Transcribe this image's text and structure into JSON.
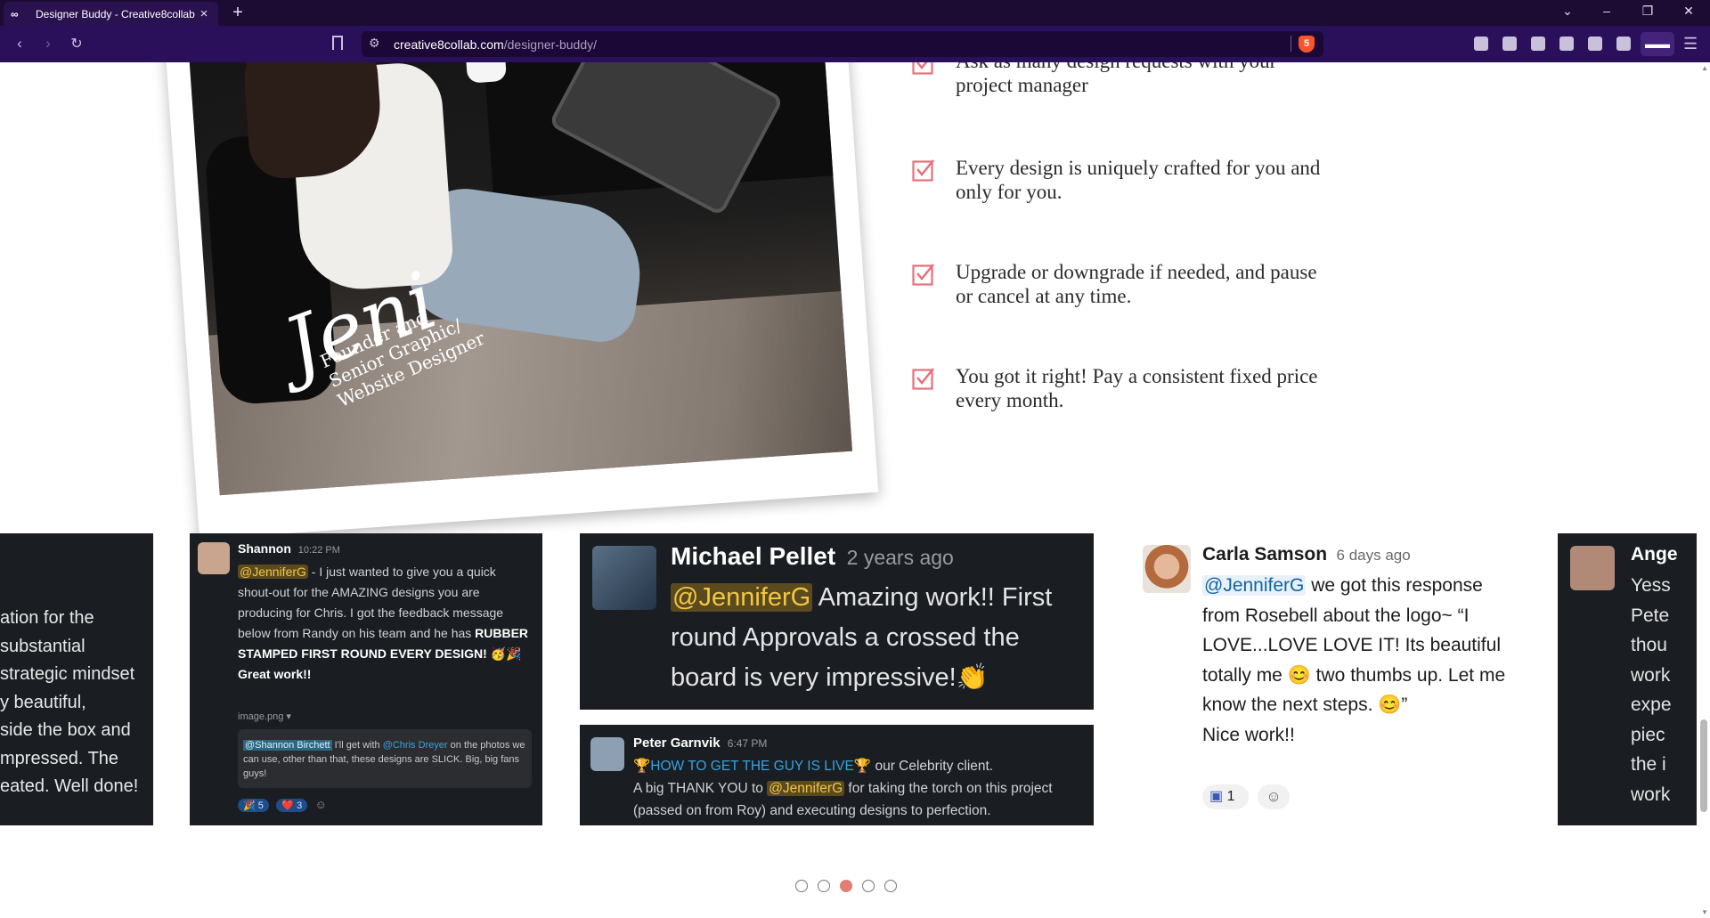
{
  "browser": {
    "tab_title": "Designer Buddy - Creative8collab",
    "tab_icon": "∞",
    "close_glyph": "×",
    "new_tab_glyph": "+",
    "url_host": "creative8collab.com",
    "url_path": "/designer-buddy/",
    "brave_badge": "5"
  },
  "features": [
    "Ask as many design requests with your project manager",
    "Every design is uniquely crafted for you and only for you.",
    "Upgrade or downgrade if needed, and pause or cancel at any time.",
    "You got it right! Pay a consistent fixed price every month."
  ],
  "photo": {
    "signature": "Jeni",
    "caption_1": "Founder and",
    "caption_2": "Senior Graphic/",
    "caption_3": "Website Designer"
  },
  "testimonials": {
    "left_partial": [
      "ation for the",
      "substantial",
      "strategic mindset",
      "y beautiful,",
      "side the box and",
      "mpressed. The",
      "eated. Well done!"
    ],
    "shannon": {
      "name": "Shannon",
      "time": "10:22 PM",
      "mention": "@JenniferG",
      "text": " - I just wanted to give you a quick shout-out for the AMAZING designs you are producing for Chris. I got the feedback message below from Randy on his team and he has ",
      "bold": "RUBBER STAMPED FIRST ROUND EVERY DESIGN!",
      "after": " 🥳🎉 Great work!!",
      "attachment": "image.png ▾",
      "quote_mention": "@Shannon Birchett",
      "quote_text_1": " I'll get with ",
      "quote_mention_2": "@Chris Dreyer",
      "quote_text_2": " on the photos we can use, other than that, these designs are SLICK. Big, big fans guys!",
      "reaction_1": "🎉 5",
      "reaction_2": "❤️ 3"
    },
    "michael": {
      "name": "Michael Pellet",
      "time": "2 years ago",
      "mention": "@JenniferG",
      "text": " Amazing work!!  First round Approvals a crossed the board is very impressive!👏"
    },
    "peter": {
      "name": "Peter Garnvik",
      "time": "6:47 PM",
      "link": "🏆HOW TO GET THE GUY IS LIVE🏆",
      "text_1": " our Celebrity client.",
      "text_2": "A big THANK YOU to ",
      "mention": "@JenniferG",
      "text_3": " for taking the torch on this project (passed on from Roy) and executing designs to perfection."
    },
    "carla": {
      "name": "Carla Samson",
      "time": "6 days ago",
      "mention": "@JenniferG",
      "text": " we got this response from Rosebell about the logo~ “I LOVE...LOVE LOVE IT! Its beautiful totally me 😊 two thumbs up. Let me know the next steps. 😊”",
      "closing": "Nice work!!",
      "reaction": "1"
    },
    "right_partial": {
      "name": "Ange",
      "lines": [
        "Yess",
        "Pete",
        "thou",
        "work",
        "expe",
        "piec",
        "the i",
        "work"
      ]
    }
  },
  "carousel": {
    "slides": 5,
    "active": 3
  }
}
